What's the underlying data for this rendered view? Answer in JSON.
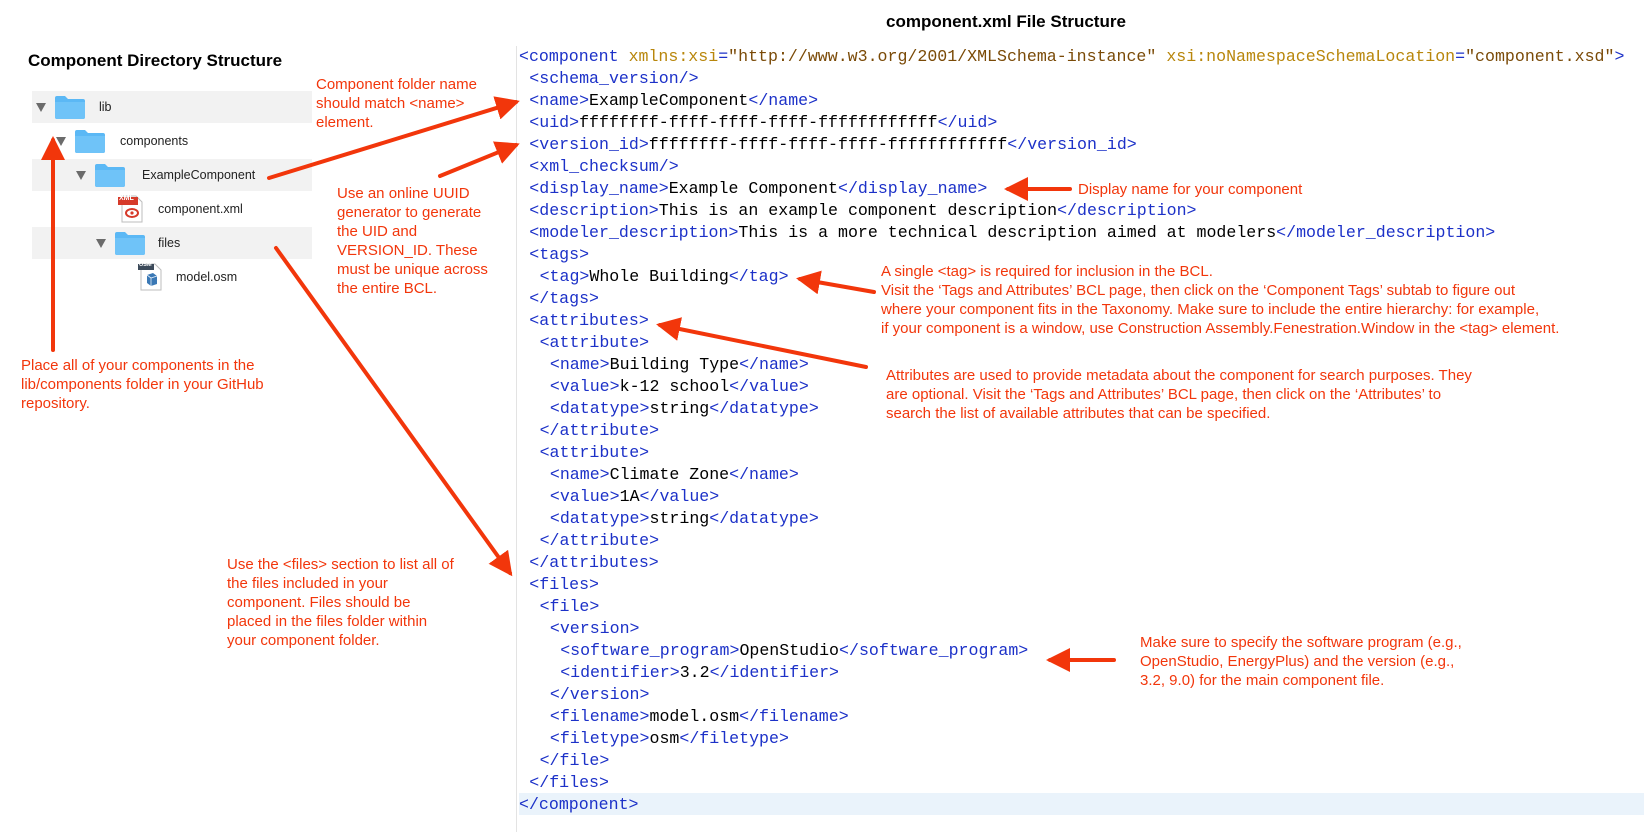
{
  "left_title": "Component Directory Structure",
  "right_title": "component.xml File Structure",
  "tree": {
    "lib": "lib",
    "components": "components",
    "example_component": "ExampleComponent",
    "component_xml": "component.xml",
    "files": "files",
    "model_osm": "model.osm",
    "xml_badge": "XML",
    "osm_badge": "OSM"
  },
  "notes": {
    "folder_name": [
      "Component folder name",
      "should match <name>",
      "element."
    ],
    "uuid": [
      "Use an online UUID",
      "generator to generate",
      "the UID and",
      "VERSION_ID. These",
      "must be unique across",
      "the entire BCL."
    ],
    "place": [
      "Place all of your components in the",
      "lib/components folder in your GitHub",
      "repository."
    ],
    "files_section": [
      "Use the <files> section to list all of",
      "the files included in your",
      "component.  Files should be",
      "placed in the files folder within",
      "your component folder."
    ],
    "display_name": [
      "Display name for your component"
    ],
    "tag": [
      "A single <tag> is required for inclusion in the BCL.",
      "Visit the ‘Tags and Attributes’ BCL page, then click on the ‘Component Tags’ subtab to figure out",
      "where your component fits in the Taxonomy.  Make sure to include the entire hierarchy: for example,",
      "if your component is a window, use Construction Assembly.Fenestration.Window in the <tag> element."
    ],
    "attributes": [
      "Attributes are used to provide metadata about the component for search purposes. They",
      "are optional. Visit the ‘Tags and Attributes’ BCL page, then click on the ‘Attributes’ to",
      "search the list of available attributes that can be specified."
    ],
    "software": [
      "Make sure to specify the software program (e.g.,",
      "OpenStudio, EnergyPlus) and the version (e.g.,",
      "3.2, 9.0) for the main component file."
    ]
  },
  "xml_lines": [
    {
      "indent": 0,
      "parts": [
        [
          "t",
          "<component"
        ],
        [
          "v",
          " "
        ],
        [
          "an",
          "xmlns:xsi"
        ],
        [
          "t",
          "="
        ],
        [
          "av",
          "\"http://www.w3.org/2001/XMLSchema-instance\""
        ],
        [
          "v",
          " "
        ],
        [
          "an",
          "xsi:noNamespaceSchemaLocation"
        ],
        [
          "t",
          "="
        ],
        [
          "av",
          "\"component.xsd\""
        ],
        [
          "t",
          ">"
        ]
      ]
    },
    {
      "indent": 1,
      "parts": [
        [
          "t",
          "<schema_version/>"
        ]
      ]
    },
    {
      "indent": 1,
      "parts": [
        [
          "t",
          "<name>"
        ],
        [
          "v",
          "ExampleComponent"
        ],
        [
          "t",
          "</name>"
        ]
      ]
    },
    {
      "indent": 1,
      "parts": [
        [
          "t",
          "<uid>"
        ],
        [
          "v",
          "ffffffff-ffff-ffff-ffff-ffffffffffff"
        ],
        [
          "t",
          "</uid>"
        ]
      ]
    },
    {
      "indent": 1,
      "parts": [
        [
          "t",
          "<version_id>"
        ],
        [
          "v",
          "ffffffff-ffff-ffff-ffff-ffffffffffff"
        ],
        [
          "t",
          "</version_id>"
        ]
      ]
    },
    {
      "indent": 1,
      "parts": [
        [
          "t",
          "<xml_checksum/>"
        ]
      ]
    },
    {
      "indent": 1,
      "parts": [
        [
          "t",
          "<display_name>"
        ],
        [
          "v",
          "Example Component"
        ],
        [
          "t",
          "</display_name>"
        ]
      ]
    },
    {
      "indent": 1,
      "parts": [
        [
          "t",
          "<description>"
        ],
        [
          "v",
          "This is an example component description"
        ],
        [
          "t",
          "</description>"
        ]
      ]
    },
    {
      "indent": 1,
      "parts": [
        [
          "t",
          "<modeler_description>"
        ],
        [
          "v",
          "This is a more technical description aimed at modelers"
        ],
        [
          "t",
          "</modeler_description>"
        ]
      ]
    },
    {
      "indent": 1,
      "parts": [
        [
          "t",
          "<tags>"
        ]
      ]
    },
    {
      "indent": 2,
      "parts": [
        [
          "t",
          "<tag>"
        ],
        [
          "v",
          "Whole Building"
        ],
        [
          "t",
          "</tag>"
        ]
      ]
    },
    {
      "indent": 1,
      "parts": [
        [
          "t",
          "</tags>"
        ]
      ]
    },
    {
      "indent": 1,
      "parts": [
        [
          "t",
          "<attributes>"
        ]
      ]
    },
    {
      "indent": 2,
      "parts": [
        [
          "t",
          "<attribute>"
        ]
      ]
    },
    {
      "indent": 3,
      "parts": [
        [
          "t",
          "<name>"
        ],
        [
          "v",
          "Building Type"
        ],
        [
          "t",
          "</name>"
        ]
      ]
    },
    {
      "indent": 3,
      "parts": [
        [
          "t",
          "<value>"
        ],
        [
          "v",
          "k-12 school"
        ],
        [
          "t",
          "</value>"
        ]
      ]
    },
    {
      "indent": 3,
      "parts": [
        [
          "t",
          "<datatype>"
        ],
        [
          "v",
          "string"
        ],
        [
          "t",
          "</datatype>"
        ]
      ]
    },
    {
      "indent": 2,
      "parts": [
        [
          "t",
          "</attribute>"
        ]
      ]
    },
    {
      "indent": 2,
      "parts": [
        [
          "t",
          "<attribute>"
        ]
      ]
    },
    {
      "indent": 3,
      "parts": [
        [
          "t",
          "<name>"
        ],
        [
          "v",
          "Climate Zone"
        ],
        [
          "t",
          "</name>"
        ]
      ]
    },
    {
      "indent": 3,
      "parts": [
        [
          "t",
          "<value>"
        ],
        [
          "v",
          "1A"
        ],
        [
          "t",
          "</value>"
        ]
      ]
    },
    {
      "indent": 3,
      "parts": [
        [
          "t",
          "<datatype>"
        ],
        [
          "v",
          "string"
        ],
        [
          "t",
          "</datatype>"
        ]
      ]
    },
    {
      "indent": 2,
      "parts": [
        [
          "t",
          "</attribute>"
        ]
      ]
    },
    {
      "indent": 1,
      "parts": [
        [
          "t",
          "</attributes>"
        ]
      ]
    },
    {
      "indent": 1,
      "parts": [
        [
          "t",
          "<files>"
        ]
      ]
    },
    {
      "indent": 2,
      "parts": [
        [
          "t",
          "<file>"
        ]
      ]
    },
    {
      "indent": 3,
      "parts": [
        [
          "t",
          "<version>"
        ]
      ]
    },
    {
      "indent": 4,
      "parts": [
        [
          "t",
          "<software_program>"
        ],
        [
          "v",
          "OpenStudio"
        ],
        [
          "t",
          "</software_program>"
        ]
      ]
    },
    {
      "indent": 4,
      "parts": [
        [
          "t",
          "<identifier>"
        ],
        [
          "v",
          "3.2"
        ],
        [
          "t",
          "</identifier>"
        ]
      ]
    },
    {
      "indent": 3,
      "parts": [
        [
          "t",
          "</version>"
        ]
      ]
    },
    {
      "indent": 3,
      "parts": [
        [
          "t",
          "<filename>"
        ],
        [
          "v",
          "model.osm"
        ],
        [
          "t",
          "</filename>"
        ]
      ]
    },
    {
      "indent": 3,
      "parts": [
        [
          "t",
          "<filetype>"
        ],
        [
          "v",
          "osm"
        ],
        [
          "t",
          "</filetype>"
        ]
      ]
    },
    {
      "indent": 2,
      "parts": [
        [
          "t",
          "</file>"
        ]
      ]
    },
    {
      "indent": 1,
      "parts": [
        [
          "t",
          "</files>"
        ]
      ]
    },
    {
      "indent": 0,
      "parts": [
        [
          "t",
          "</component>"
        ]
      ]
    }
  ],
  "colors": {
    "annotation_red": "#f2360b",
    "xml_tag_blue": "#1c31c8",
    "folder_blue": "#5bb8f5",
    "row_shade": "#f2f2f2"
  },
  "icons": [
    "folder-icon",
    "xml-file-icon",
    "osm-file-icon",
    "disclosure-triangle-icon"
  ]
}
